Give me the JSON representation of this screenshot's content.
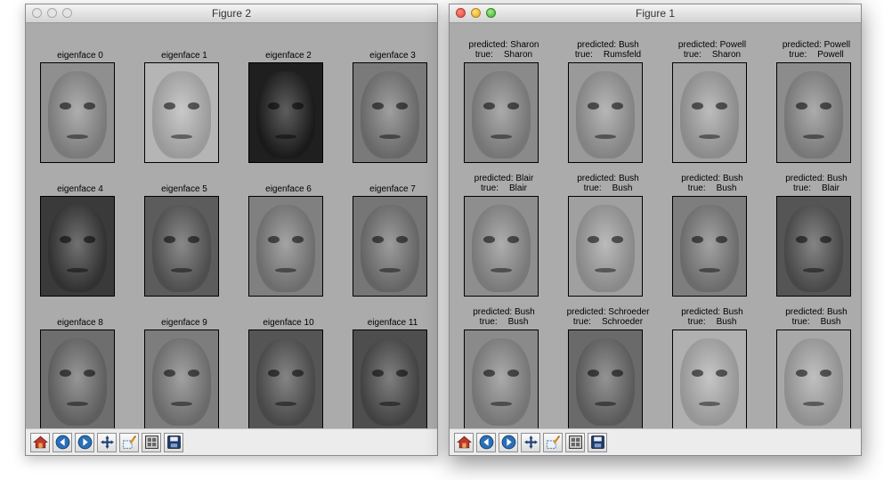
{
  "windows": [
    {
      "id": "win2",
      "title": "Figure 2",
      "active": false,
      "cells": [
        {
          "title": "eigenface 0",
          "tone": "#8f8f8f"
        },
        {
          "title": "eigenface 1",
          "tone": "#b5b5b5"
        },
        {
          "title": "eigenface 2",
          "tone": "#1f1f1f"
        },
        {
          "title": "eigenface 3",
          "tone": "#7a7a7a"
        },
        {
          "title": "eigenface 4",
          "tone": "#3a3a3a"
        },
        {
          "title": "eigenface 5",
          "tone": "#5c5c5c"
        },
        {
          "title": "eigenface 6",
          "tone": "#808080"
        },
        {
          "title": "eigenface 7",
          "tone": "#767676"
        },
        {
          "title": "eigenface 8",
          "tone": "#6e6e6e"
        },
        {
          "title": "eigenface 9",
          "tone": "#7d7d7d"
        },
        {
          "title": "eigenface 10",
          "tone": "#555555"
        },
        {
          "title": "eigenface 11",
          "tone": "#4e4e4e"
        }
      ]
    },
    {
      "id": "win1",
      "title": "Figure 1",
      "active": true,
      "cells": [
        {
          "predicted": "predicted: Sharon",
          "true_label": "true:",
          "true_name": "Sharon",
          "tone": "#8a8a8a"
        },
        {
          "predicted": "predicted: Bush",
          "true_label": "true:",
          "true_name": "Rumsfeld",
          "tone": "#9a9a9a"
        },
        {
          "predicted": "predicted: Powell",
          "true_label": "true:",
          "true_name": "Sharon",
          "tone": "#a3a3a3"
        },
        {
          "predicted": "predicted: Powell",
          "true_label": "true:",
          "true_name": "Powell",
          "tone": "#8c8c8c"
        },
        {
          "predicted": "predicted: Blair",
          "true_label": "true:",
          "true_name": "Blair",
          "tone": "#8e8e8e"
        },
        {
          "predicted": "predicted: Bush",
          "true_label": "true:",
          "true_name": "Bush",
          "tone": "#a0a0a0"
        },
        {
          "predicted": "predicted: Bush",
          "true_label": "true:",
          "true_name": "Bush",
          "tone": "#7e7e7e"
        },
        {
          "predicted": "predicted: Bush",
          "true_label": "true:",
          "true_name": "Blair",
          "tone": "#555555"
        },
        {
          "predicted": "predicted: Bush",
          "true_label": "true:",
          "true_name": "Bush",
          "tone": "#8a8a8a"
        },
        {
          "predicted": "predicted: Schroeder",
          "true_label": "true:",
          "true_name": "Schroeder",
          "tone": "#6a6a6a"
        },
        {
          "predicted": "predicted: Bush",
          "true_label": "true:",
          "true_name": "Bush",
          "tone": "#b0b0b0"
        },
        {
          "predicted": "predicted: Bush",
          "true_label": "true:",
          "true_name": "Bush",
          "tone": "#a8a8a8"
        }
      ]
    }
  ],
  "toolbar": [
    {
      "name": "home-button",
      "icon": "home-icon"
    },
    {
      "name": "back-button",
      "icon": "back-arrow-icon"
    },
    {
      "name": "forward-button",
      "icon": "forward-arrow-icon"
    },
    {
      "name": "pan-button",
      "icon": "pan-arrows-icon"
    },
    {
      "name": "zoom-button",
      "icon": "zoom-rect-icon"
    },
    {
      "name": "subplots-button",
      "icon": "subplots-config-icon"
    },
    {
      "name": "save-button",
      "icon": "floppy-disk-icon"
    }
  ],
  "colors": {
    "figure_bg": "#ababab",
    "toolbar_bg": "#ececec",
    "titlebar_text": "#333333"
  }
}
